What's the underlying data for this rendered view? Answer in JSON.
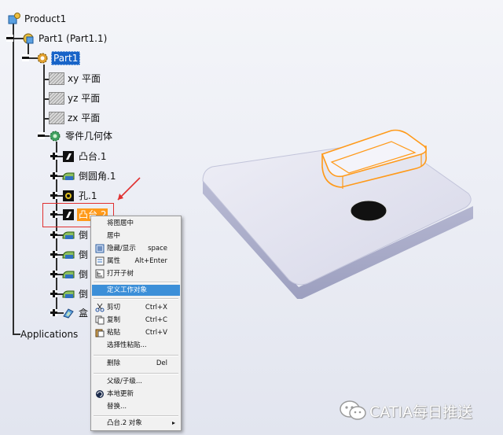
{
  "tree": {
    "product": "Product1",
    "part_node": "Part1 (Part1.1)",
    "part_body": "Part1",
    "planes": [
      "xy 平面",
      "yz 平面",
      "zx 平面"
    ],
    "geometry_set": "零件几何体",
    "features": [
      "凸台.1",
      "倒圆角.1",
      "孔.1",
      "凸台.2",
      "倒",
      "倒",
      "倒",
      "倒",
      "盒"
    ],
    "applications": "Applications"
  },
  "context_menu": {
    "items": [
      {
        "label": "将图居中",
        "shortcut": ""
      },
      {
        "label": "居中",
        "shortcut": ""
      },
      {
        "label": "隐藏/显示",
        "shortcut": "space"
      },
      {
        "label": "属性",
        "shortcut": "Alt+Enter"
      },
      {
        "label": "打开子树",
        "shortcut": ""
      },
      {
        "label": "定义工作对象",
        "shortcut": ""
      },
      {
        "label": "剪切",
        "shortcut": "Ctrl+X"
      },
      {
        "label": "复制",
        "shortcut": "Ctrl+C"
      },
      {
        "label": "粘贴",
        "shortcut": "Ctrl+V"
      },
      {
        "label": "选择性粘贴...",
        "shortcut": ""
      },
      {
        "label": "删除",
        "shortcut": "Del"
      },
      {
        "label": "父级/子级...",
        "shortcut": ""
      },
      {
        "label": "本地更新",
        "shortcut": ""
      },
      {
        "label": "替换...",
        "shortcut": ""
      },
      {
        "label": "凸台.2 对象",
        "shortcut": ""
      }
    ]
  },
  "watermark": "CATIA每日推送",
  "colors": {
    "selection": "#ff9a1a",
    "menu_highlight": "#3c8fd8",
    "annotation": "#e03030",
    "part_body": "#dfe0ee"
  }
}
